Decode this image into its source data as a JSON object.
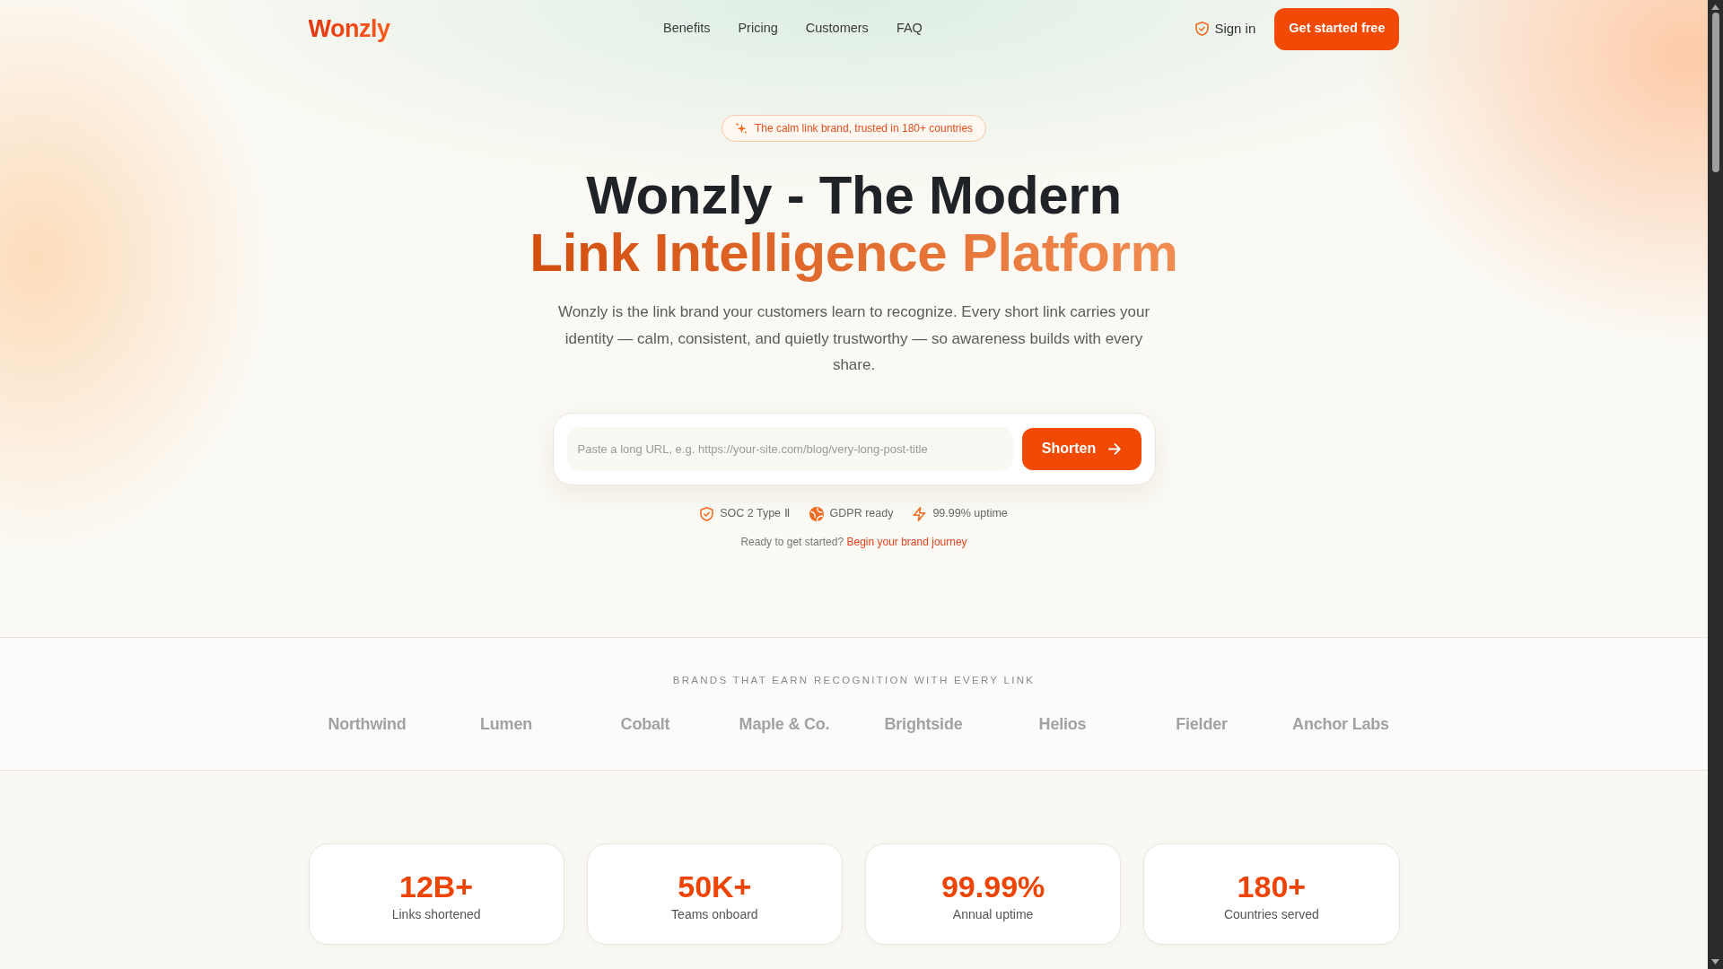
{
  "nav": {
    "logo": "Wonzly",
    "links": [
      {
        "label": "Benefits"
      },
      {
        "label": "Pricing"
      },
      {
        "label": "Customers"
      },
      {
        "label": "FAQ"
      }
    ],
    "sign_in": "Sign in",
    "cta": "Get started free"
  },
  "hero": {
    "badge": "The calm link brand, trusted in 180+ countries",
    "title_line_1": "Wonzly - The Modern",
    "title_line_2": "Link Intelligence Platform",
    "description": "Wonzly is the link brand your customers learn to recognize. Every short link carries your identity — calm, consistent, and quietly trustworthy — so awareness builds with every share.",
    "url_field": {
      "placeholder": "Paste a long URL, e.g. https://your-site.com/blog/very-long-post-title"
    },
    "submit_button": "Shorten",
    "trust_items": [
      {
        "label": "SOC 2 Type Ⅱ"
      },
      {
        "label": "GDPR ready"
      },
      {
        "label": "99.99% uptime"
      }
    ],
    "cta_line": {
      "text": "Ready to get started?",
      "link": "Begin your brand journey"
    }
  },
  "brands": {
    "heading": "BRANDS THAT EARN RECOGNITION WITH EVERY LINK",
    "names": [
      "Northwind",
      "Lumen",
      "Cobalt",
      "Maple & Co.",
      "Brightside",
      "Helios",
      "Fielder",
      "Anchor Labs"
    ]
  },
  "stats": [
    {
      "value": "12B+",
      "label": "Links shortened"
    },
    {
      "value": "50K+",
      "label": "Teams onboard"
    },
    {
      "value": "99.99%",
      "label": "Annual uptime"
    },
    {
      "value": "180+",
      "label": "Countries served"
    }
  ]
}
